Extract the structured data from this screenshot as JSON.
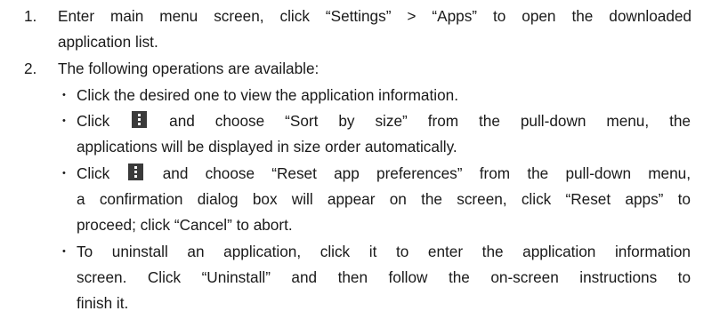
{
  "steps": [
    {
      "number": "1.",
      "lines": [
        "Enter main menu screen, click “Settings” > “Apps” to open the downloaded",
        "application list."
      ]
    },
    {
      "number": "2.",
      "lines": [
        "The following operations are available:"
      ]
    }
  ],
  "bullet_char": "•",
  "icon_name": "overflow-menu-icon",
  "operations": [
    {
      "lines": [
        "Click the desired one to view the application information."
      ]
    },
    {
      "before_icon": "Click",
      "after_icon": "and choose “Sort by size” from the pull-down menu, the",
      "lines": [
        "applications will be displayed in size order automatically."
      ]
    },
    {
      "before_icon": "Click",
      "after_icon": "and choose “Reset app preferences” from the pull-down menu,",
      "lines": [
        "a confirmation dialog box will appear on the screen, click “Reset apps” to",
        "proceed; click “Cancel” to abort."
      ]
    },
    {
      "lines": [
        "To uninstall an application, click it to enter the application information",
        "screen. Click “Uninstall” and then follow the on-screen instructions to",
        "finish it."
      ]
    }
  ]
}
